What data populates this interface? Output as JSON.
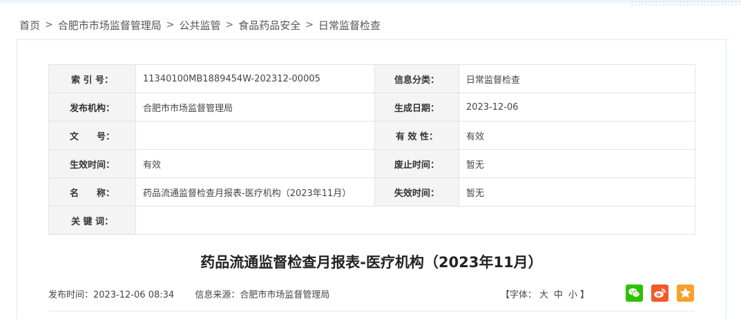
{
  "breadcrumb": {
    "items": [
      "首页",
      "合肥市市场监督管理局",
      "公共监管",
      "食品药品安全",
      "日常监督检查"
    ],
    "separator": ">"
  },
  "meta": {
    "index_label": "索 引 号：",
    "index_value": "11340100MB1889454W-202312-00005",
    "category_label": "信息分类：",
    "category_value": "日常监督检查",
    "publisher_label": "发布机构：",
    "publisher_value": "合肥市市场监督管理局",
    "created_label": "生成日期：",
    "created_value": "2023-12-06",
    "docno_label": "文　　号：",
    "docno_value": "",
    "validity_label": "有 效 性：",
    "validity_value": "有效",
    "effective_label": "生效时间：",
    "effective_value": "有效",
    "repeal_label": "废止时间：",
    "repeal_value": "暂无",
    "name_label": "名　　称：",
    "name_value": "药品流通监督检查月报表-医疗机构（2023年11月）",
    "expire_label": "失效时间：",
    "expire_value": "暂无",
    "keywords_label": "关 键 词：",
    "keywords_value": ""
  },
  "article": {
    "title": "药品流通监督检查月报表-医疗机构（2023年11月）",
    "publish_time_label": "发布时间：",
    "publish_time": "2023-12-06 08:34",
    "source_label": "信息来源：",
    "source": "合肥市市场监督管理局",
    "font_label_open": "【字体：",
    "font_large": "大",
    "font_medium": "中",
    "font_small": "小",
    "font_label_close": "】"
  },
  "share": {
    "icons": [
      "wechat-icon",
      "weibo-icon",
      "favorite-star-icon"
    ],
    "colors": {
      "wechat": "#2dc100",
      "weibo": "#ef5b2c",
      "favorite": "#f6a22a"
    }
  }
}
